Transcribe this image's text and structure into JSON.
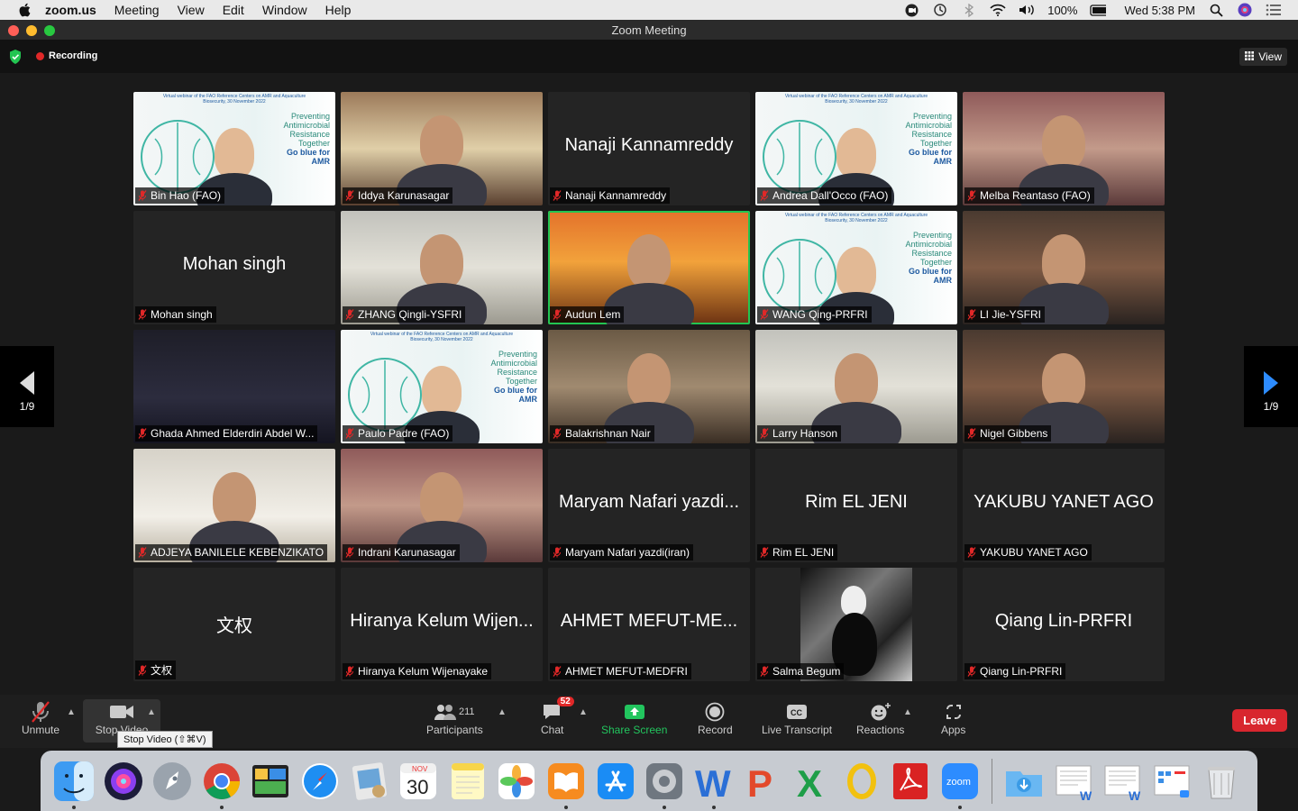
{
  "menubar": {
    "app": "zoom.us",
    "items": [
      "Meeting",
      "View",
      "Edit",
      "Window",
      "Help"
    ],
    "battery": "100%",
    "clock": "Wed 5:38 PM"
  },
  "window": {
    "title": "Zoom Meeting"
  },
  "topbar": {
    "recording": "Recording",
    "view": "View"
  },
  "pager": {
    "left": "1/9",
    "right": "1/9"
  },
  "participants": [
    {
      "name": "Bin Hao (FAO)",
      "big": "",
      "video": true,
      "bg": "webinar"
    },
    {
      "name": "Iddya Karunasagar",
      "big": "",
      "video": true,
      "bg": "bg2"
    },
    {
      "name": "Nanaji Kannamreddy",
      "big": "Nanaji Kannamreddy",
      "video": false
    },
    {
      "name": "Andrea Dall'Occo (FAO)",
      "big": "",
      "video": true,
      "bg": "webinar"
    },
    {
      "name": "Melba Reantaso (FAO)",
      "big": "",
      "video": true,
      "bg": "bg9"
    },
    {
      "name": "Mohan singh",
      "big": "Mohan singh",
      "video": false
    },
    {
      "name": "ZHANG Qingli-YSFRI",
      "big": "",
      "video": true,
      "bg": "bg4"
    },
    {
      "name": "Audun Lem",
      "big": "",
      "video": true,
      "bg": "bg3",
      "active": true
    },
    {
      "name": "WANG Qing-PRFRI",
      "big": "",
      "video": true,
      "bg": "webinar"
    },
    {
      "name": "LI Jie-YSFRI",
      "big": "",
      "video": true,
      "bg": "bg5"
    },
    {
      "name": "Ghada Ahmed Elderdiri Abdel W...",
      "big": "",
      "video": true,
      "bg": "bg8"
    },
    {
      "name": "Paulo Padre (FAO)",
      "big": "",
      "video": true,
      "bg": "webinar"
    },
    {
      "name": "Balakrishnan Nair",
      "big": "",
      "video": true,
      "bg": "bg6"
    },
    {
      "name": "Larry Hanson",
      "big": "",
      "video": true,
      "bg": "bg4"
    },
    {
      "name": "Nigel Gibbens",
      "big": "",
      "video": true,
      "bg": "bg5"
    },
    {
      "name": "ADJEYA BANILELE KEBENZIKATO",
      "big": "",
      "video": true,
      "bg": "bg7"
    },
    {
      "name": "Indrani Karunasagar",
      "big": "",
      "video": true,
      "bg": "bg9"
    },
    {
      "name": "Maryam Nafari yazdi(iran)",
      "big": "Maryam Nafari yazdi...",
      "video": false
    },
    {
      "name": "Rim EL JENI",
      "big": "Rim EL JENI",
      "video": false
    },
    {
      "name": "YAKUBU YANET AGO",
      "big": "YAKUBU YANET AGO",
      "video": false
    },
    {
      "name": "文权",
      "big": "文权",
      "video": false
    },
    {
      "name": "Hiranya Kelum Wijenayake",
      "big": "Hiranya Kelum Wijen...",
      "video": false
    },
    {
      "name": "AHMET MEFUT-MEDFRI",
      "big": "AHMET MEFUT-ME...",
      "video": false
    },
    {
      "name": "Salma Begum",
      "big": "",
      "video": true,
      "bg": "photo-bw"
    },
    {
      "name": "Qiang Lin-PRFRI",
      "big": "Qiang Lin-PRFRI",
      "video": false
    }
  ],
  "webinar": {
    "heading": "Virtual webinar of the FAO Reference Centers on AMR and Aquaculture Biosecurity, 30 November 2022",
    "line1": "Preventing",
    "line2": "Antimicrobial",
    "line3": "Resistance",
    "line4": "Together",
    "line5": "Go blue for",
    "line6": "AMR"
  },
  "controls": {
    "unmute": "Unmute",
    "stop_video": "Stop Video",
    "participants": "Participants",
    "participant_count": "211",
    "chat": "Chat",
    "chat_badge": "52",
    "share": "Share Screen",
    "record": "Record",
    "transcript": "Live Transcript",
    "reactions": "Reactions",
    "apps": "Apps",
    "leave": "Leave",
    "tooltip": "Stop Video (⇧⌘V)"
  },
  "dock": {
    "calendar_month": "NOV",
    "calendar_day": "30",
    "zoom_label": "zoom"
  },
  "colors": {
    "accent_green": "#23c552",
    "leave_red": "#d8262e",
    "share_green": "#22c55e",
    "mute_red": "#e02828"
  }
}
